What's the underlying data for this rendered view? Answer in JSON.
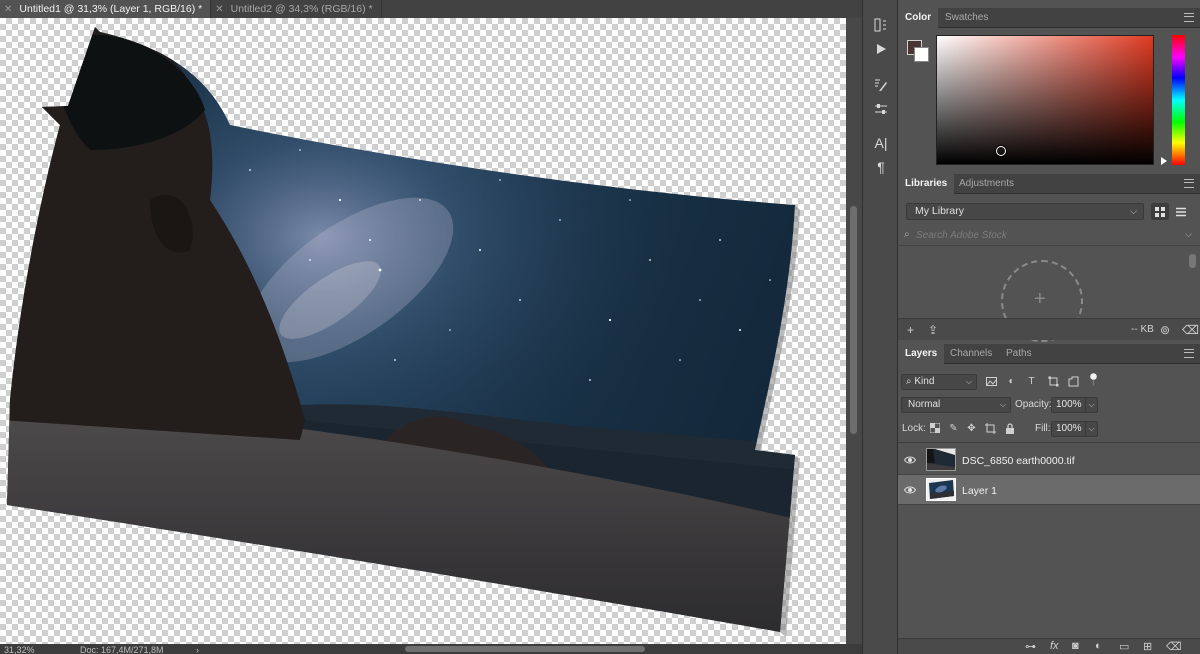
{
  "tabs": [
    {
      "label": "Untitled1 @ 31,3% (Layer 1, RGB/16) *",
      "active": true
    },
    {
      "label": "Untitled2 @ 34,3% (RGB/16) *",
      "active": false
    }
  ],
  "status": {
    "zoom": "31,32%",
    "doc": "Doc: 167,4M/271,8M",
    "arrow": "›"
  },
  "color_panel": {
    "tabs": [
      "Color",
      "Swatches"
    ],
    "foreground": "#4a3535",
    "background": "#ffffff",
    "hue": "#e03a22"
  },
  "libraries_panel": {
    "tabs": [
      "Libraries",
      "Adjustments"
    ],
    "library": "My Library",
    "search_placeholder": "Search Adobe Stock",
    "size": "-- KB"
  },
  "layers_panel": {
    "tabs": [
      "Layers",
      "Channels",
      "Paths"
    ],
    "kind": "Kind",
    "blend_mode": "Normal",
    "opacity_label": "Opacity:",
    "opacity": "100%",
    "lock_label": "Lock:",
    "fill_label": "Fill:",
    "fill": "100%",
    "layers": [
      {
        "name": "DSC_6850 earth0000.tif",
        "visible": true,
        "selected": false
      },
      {
        "name": "Layer 1",
        "visible": true,
        "selected": true
      }
    ]
  },
  "icons": {
    "tool_column": [
      "history-icon",
      "play-icon",
      "brush-settings-icon",
      "properties-icon",
      "character-icon",
      "paragraph-icon"
    ],
    "filter": [
      "pixel-filter-icon",
      "adjustment-filter-icon",
      "type-filter-icon",
      "shape-filter-icon",
      "smart-object-filter-icon",
      "filter-toggle-icon"
    ],
    "lock": [
      "lock-transparent-icon",
      "lock-image-icon",
      "lock-position-icon",
      "lock-artboard-icon",
      "lock-all-icon"
    ],
    "layers_footer": [
      "link-icon",
      "fx-icon",
      "mask-icon",
      "adjustment-layer-icon",
      "group-icon",
      "new-layer-icon",
      "trash-icon"
    ]
  }
}
